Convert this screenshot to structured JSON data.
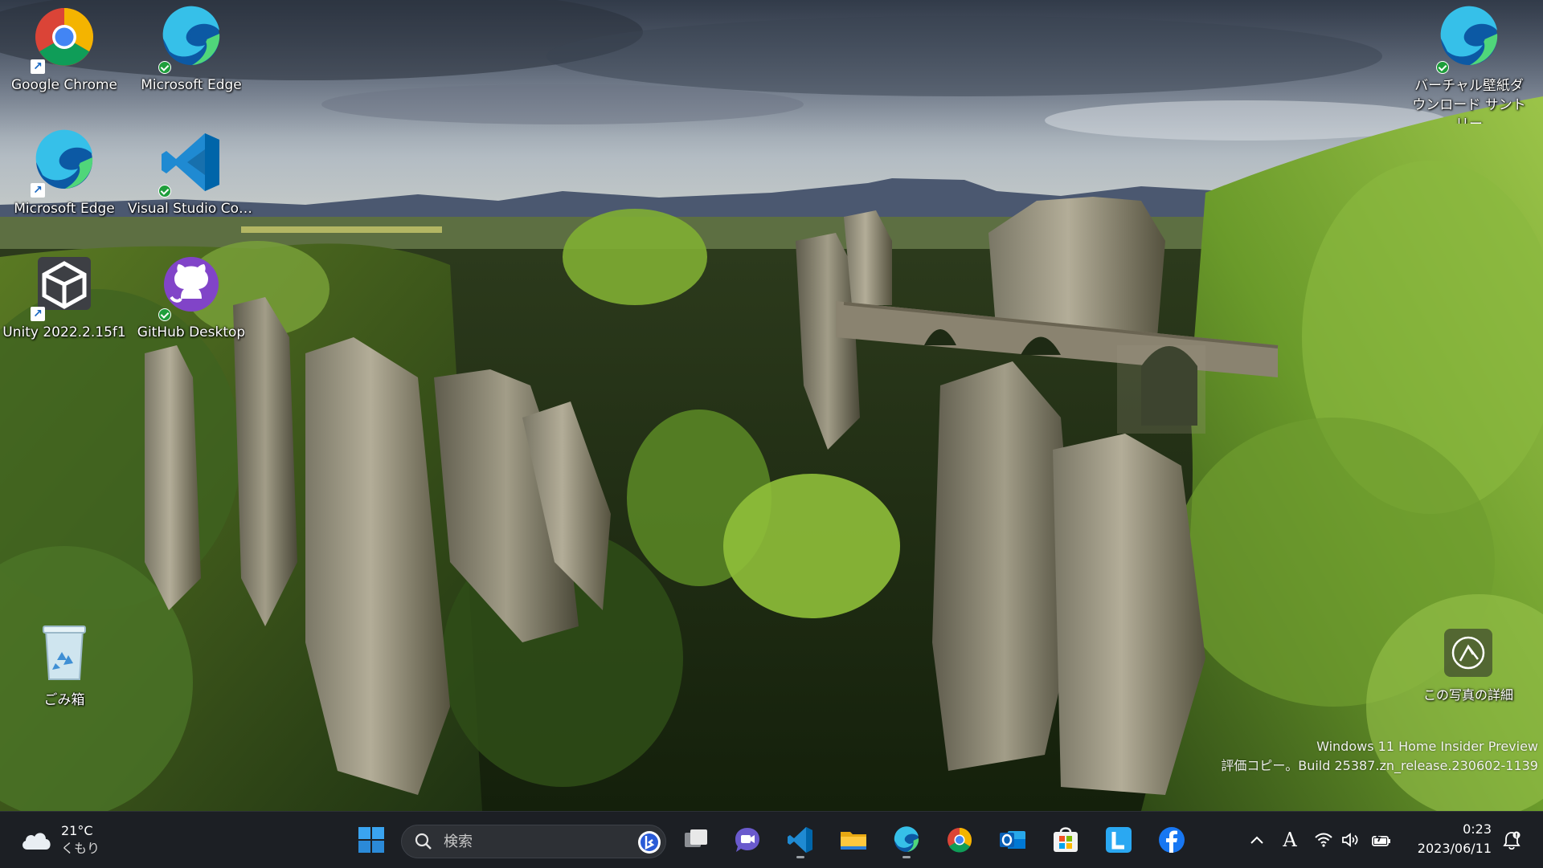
{
  "desktop": {
    "icons": [
      {
        "label": "Google Chrome",
        "icon": "chrome-icon",
        "badge": "shortcut"
      },
      {
        "label": "Microsoft Edge",
        "icon": "edge-icon",
        "badge": "synced"
      },
      {
        "label": "Microsoft Edge",
        "icon": "edge-icon",
        "badge": "shortcut"
      },
      {
        "label": "Visual Studio Code",
        "icon": "vscode-icon",
        "badge": "synced"
      },
      {
        "label": "Unity 2022.2.15f1",
        "icon": "unity-icon",
        "badge": "shortcut"
      },
      {
        "label": "GitHub Desktop",
        "icon": "github-icon",
        "badge": "synced"
      },
      {
        "label": "ごみ箱",
        "icon": "recycle-bin-icon",
        "badge": ""
      },
      {
        "label": "バーチャル壁紙ダウンロード サントリー",
        "icon": "edge-icon",
        "badge": "synced"
      }
    ],
    "photo_info_label": "この写真の詳細",
    "watermark": {
      "line1": "Windows 11 Home Insider Preview",
      "line2": "評価コピー。Build 25387.zn_release.230602-1139"
    }
  },
  "taskbar": {
    "weather": {
      "temp": "21°C",
      "condition": "くもり",
      "icon": "cloud-icon"
    },
    "search": {
      "placeholder": "検索"
    },
    "apps": [
      "start-icon",
      "task-view-icon",
      "teams-chat-icon",
      "vscode-icon",
      "file-explorer-icon",
      "edge-icon",
      "chrome-icon",
      "outlook-icon",
      "store-icon",
      "line-icon",
      "facebook-icon"
    ],
    "tray": {
      "ime": "A",
      "icons": [
        "chevron-up-icon",
        "wifi-icon",
        "volume-icon",
        "battery-icon"
      ]
    },
    "clock": {
      "time": "0:23",
      "date": "2023/06/11"
    }
  },
  "colors": {
    "taskbar_bg": "#1c1f24",
    "accent": "#0078d4"
  }
}
